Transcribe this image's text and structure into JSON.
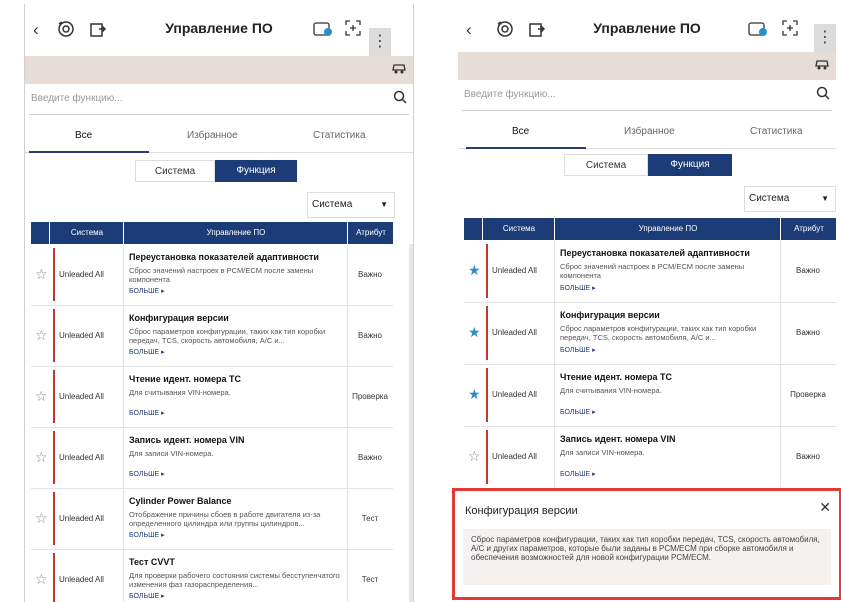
{
  "header": {
    "title": "Управление ПО",
    "back_icon": "‹",
    "menu_icon": "⋮"
  },
  "search": {
    "placeholder": "Введите функцию..."
  },
  "tabs": [
    "Все",
    "Избранное",
    "Статистика"
  ],
  "toggle": [
    "Система",
    "Функция"
  ],
  "dropdown": {
    "value": "Система"
  },
  "table": {
    "headers": [
      "Система",
      "Управление ПО",
      "Атрибут"
    ],
    "more_label": "БОЛЬШЕ ▸",
    "rows": [
      {
        "system": "Unleaded All",
        "title": "Переустановка показателей адаптивности",
        "desc": "Сброс значений настроек в PCM/ECM после замены компонента",
        "attr": "Важно"
      },
      {
        "system": "Unleaded All",
        "title": "Конфигурация версии",
        "desc": "Сброс параметров конфигурации, таких как тип коробки передач, TCS, скорость автомобиля, A/C и...",
        "attr": "Важно"
      },
      {
        "system": "Unleaded All",
        "title": "Чтение идент. номера ТС",
        "desc": "Для считывания VIN-номера.",
        "attr": "Проверка"
      },
      {
        "system": "Unleaded All",
        "title": "Запись идент. номера VIN",
        "desc": "Для записи VIN-номера.",
        "attr": "Важно"
      },
      {
        "system": "Unleaded All",
        "title": "Cylinder Power Balance",
        "desc": "Отображение причины сбоев в работе двигателя из-за определенного цилиндра или группы цилиндров...",
        "attr": "Тест"
      },
      {
        "system": "Unleaded All",
        "title": "Тест CVVT",
        "desc": "Для проверки рабочего состояния системы бесступенчатого изменения фаз газораспределения...",
        "attr": "Тест"
      }
    ]
  },
  "popup": {
    "title": "Конфигурация версии",
    "close_icon": "✕",
    "text": "Сброс параметров конфигурации, таких как тип коробки передач, TCS, скорость автомобиля, A/C и других параметров, которые были заданы в PCM/ECM при сборке автомобиля и обеспечения возможностей для новой конфигурации PCM/ECM."
  },
  "colors": {
    "accent": "#1c3c78",
    "red_bar": "#c0392b",
    "highlight": "#e53935",
    "star_filled": "#2b8fc7"
  }
}
